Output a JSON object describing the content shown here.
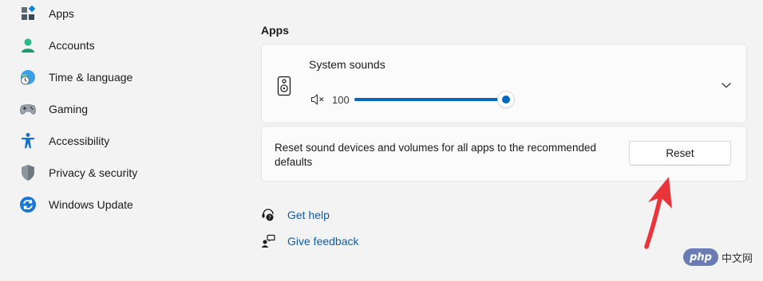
{
  "sidebar": {
    "items": [
      {
        "label": "Apps",
        "icon": "apps-icon"
      },
      {
        "label": "Accounts",
        "icon": "accounts-icon"
      },
      {
        "label": "Time & language",
        "icon": "time-language-icon"
      },
      {
        "label": "Gaming",
        "icon": "gaming-icon"
      },
      {
        "label": "Accessibility",
        "icon": "accessibility-icon"
      },
      {
        "label": "Privacy & security",
        "icon": "shield-icon"
      },
      {
        "label": "Windows Update",
        "icon": "windows-update-icon"
      }
    ]
  },
  "main": {
    "section_title": "Apps",
    "system_sounds": {
      "title": "System sounds",
      "volume": "100",
      "volume_fraction": 1.0
    },
    "reset": {
      "description": "Reset sound devices and volumes for all apps to the recommended defaults",
      "button_label": "Reset"
    },
    "links": [
      {
        "label": "Get help",
        "icon": "get-help-icon"
      },
      {
        "label": "Give feedback",
        "icon": "give-feedback-icon"
      }
    ]
  },
  "watermark": {
    "badge": "php",
    "text": "中文网"
  },
  "colors": {
    "accent": "#0067c0",
    "link": "#0f5ea8",
    "arrow": "#e8343a",
    "background": "#f3f3f3",
    "card": "#fbfbfb"
  }
}
